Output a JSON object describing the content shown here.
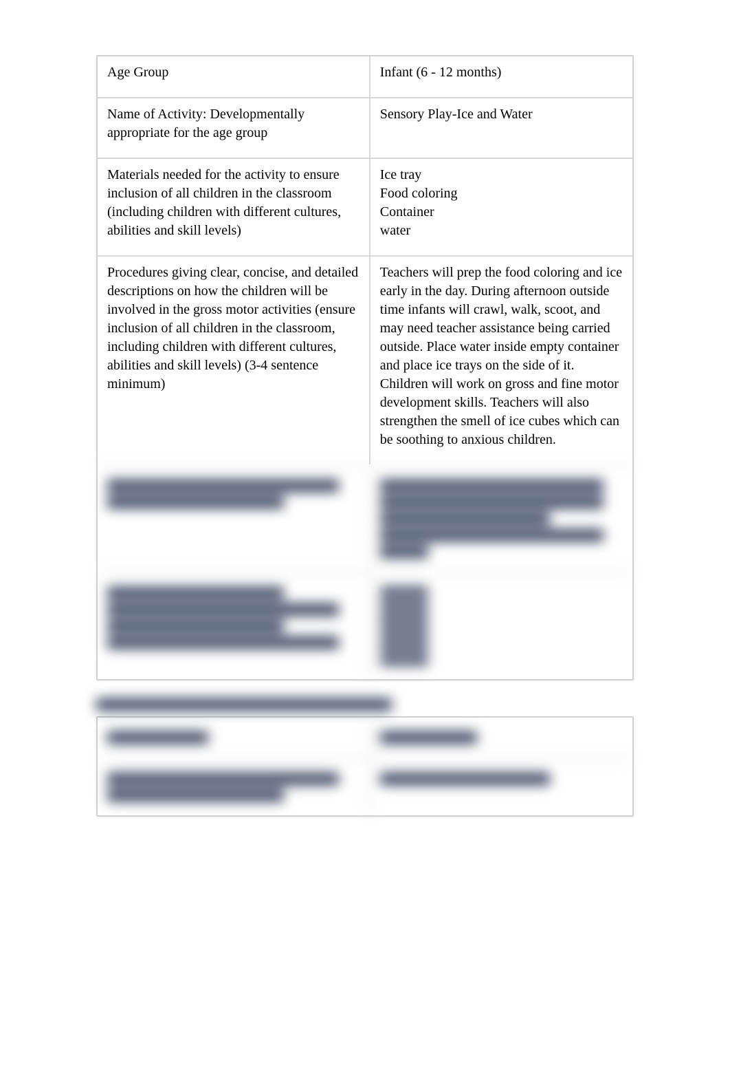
{
  "table1": {
    "row1": {
      "label": "Age Group",
      "value": "Infant (6 - 12 months)"
    },
    "row2": {
      "label": "Name of Activity:  Developmentally appropriate for the age group",
      "value": "Sensory Play-Ice and Water"
    },
    "row3": {
      "label": "Materials needed for the activity    to ensure inclusion of all children in the classroom (including children with different cultures, abilities and skill levels)",
      "value": "Ice tray\nFood coloring\nContainer\nwater"
    },
    "row4": {
      "label": "Procedures   giving clear, concise, and detailed descriptions on how the children will be involved in the gross motor activities (ensure inclusion of all children in the classroom, including children with different cultures, abilities and skill levels) (3-4 sentence minimum)",
      "value": "Teachers will prep the food coloring and ice early in the day. During afternoon outside time infants will crawl, walk, scoot, and may need teacher assistance being carried outside. Place water inside empty container and place ice trays on the side of it. Children will work on gross and fine motor development skills. Teachers will also strengthen the smell of ice cubes which can be soothing to anxious children."
    }
  }
}
